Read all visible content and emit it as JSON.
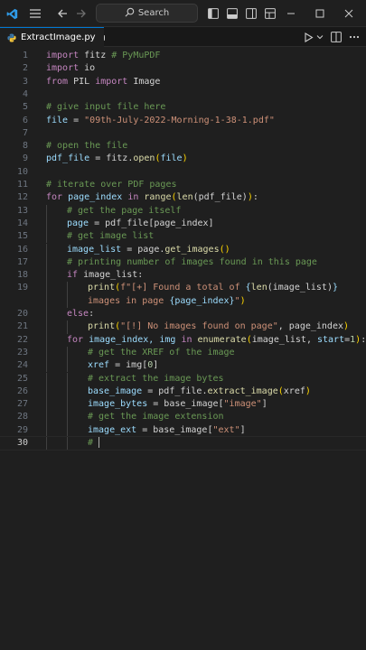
{
  "window": {
    "search_label": "Search"
  },
  "tab": {
    "filename": "ExtractImage.py"
  },
  "colors": {
    "accent": "#0078d4",
    "editor_bg": "#1f1f1f",
    "keyword": "#c586c0",
    "function": "#dcdcaa",
    "comment": "#6a9955",
    "string": "#ce9178",
    "variable": "#9cdcfe"
  },
  "editor": {
    "cursor_line": 30,
    "lines": [
      {
        "n": "1",
        "indent": 0,
        "tokens": [
          {
            "t": "import",
            "c": "kw"
          },
          {
            "t": " fitz ",
            "c": "df"
          },
          {
            "t": "# PyMuPDF",
            "c": "cm"
          }
        ]
      },
      {
        "n": "2",
        "indent": 0,
        "tokens": [
          {
            "t": "import",
            "c": "kw"
          },
          {
            "t": " io",
            "c": "df"
          }
        ]
      },
      {
        "n": "3",
        "indent": 0,
        "tokens": [
          {
            "t": "from",
            "c": "kw"
          },
          {
            "t": " PIL ",
            "c": "df"
          },
          {
            "t": "import",
            "c": "kw"
          },
          {
            "t": " Image",
            "c": "df"
          }
        ]
      },
      {
        "n": "4",
        "indent": 0,
        "tokens": []
      },
      {
        "n": "5",
        "indent": 0,
        "tokens": [
          {
            "t": "# give input file here",
            "c": "cm"
          }
        ]
      },
      {
        "n": "6",
        "indent": 0,
        "tokens": [
          {
            "t": "file",
            "c": "vr"
          },
          {
            "t": " = ",
            "c": "df"
          },
          {
            "t": "\"09th-July-2022-Morning-1-38-1.pdf\"",
            "c": "st"
          }
        ]
      },
      {
        "n": "7",
        "indent": 0,
        "tokens": []
      },
      {
        "n": "8",
        "indent": 0,
        "tokens": [
          {
            "t": "# open the file",
            "c": "cm"
          }
        ]
      },
      {
        "n": "9",
        "indent": 0,
        "tokens": [
          {
            "t": "pdf_file",
            "c": "vr"
          },
          {
            "t": " = fitz.",
            "c": "df"
          },
          {
            "t": "open",
            "c": "fn"
          },
          {
            "t": "(",
            "c": "br"
          },
          {
            "t": "file",
            "c": "vr"
          },
          {
            "t": ")",
            "c": "br"
          }
        ]
      },
      {
        "n": "10",
        "indent": 0,
        "tokens": []
      },
      {
        "n": "11",
        "indent": 0,
        "tokens": [
          {
            "t": "# iterate over PDF pages",
            "c": "cm"
          }
        ]
      },
      {
        "n": "12",
        "indent": 0,
        "tokens": [
          {
            "t": "for",
            "c": "kw"
          },
          {
            "t": " page_index ",
            "c": "vr"
          },
          {
            "t": "in",
            "c": "kw"
          },
          {
            "t": " ",
            "c": "df"
          },
          {
            "t": "range",
            "c": "fn"
          },
          {
            "t": "(",
            "c": "br"
          },
          {
            "t": "len",
            "c": "fn"
          },
          {
            "t": "(pdf_file)",
            "c": "df"
          },
          {
            "t": ")",
            "c": "br"
          },
          {
            "t": ":",
            "c": "df"
          }
        ]
      },
      {
        "n": "13",
        "indent": 1,
        "tokens": [
          {
            "t": "# get the page itself",
            "c": "cm"
          }
        ]
      },
      {
        "n": "14",
        "indent": 1,
        "tokens": [
          {
            "t": "page",
            "c": "vr"
          },
          {
            "t": " = pdf_file[page_index]",
            "c": "df"
          }
        ]
      },
      {
        "n": "15",
        "indent": 1,
        "tokens": [
          {
            "t": "# get image list",
            "c": "cm"
          }
        ]
      },
      {
        "n": "16",
        "indent": 1,
        "tokens": [
          {
            "t": "image_list",
            "c": "vr"
          },
          {
            "t": " = page.",
            "c": "df"
          },
          {
            "t": "get_images",
            "c": "fn"
          },
          {
            "t": "()",
            "c": "br"
          }
        ]
      },
      {
        "n": "17",
        "indent": 1,
        "tokens": [
          {
            "t": "# printing number of images found in this page",
            "c": "cm"
          }
        ]
      },
      {
        "n": "18",
        "indent": 1,
        "tokens": [
          {
            "t": "if",
            "c": "kw"
          },
          {
            "t": " image_list:",
            "c": "df"
          }
        ]
      },
      {
        "n": "19",
        "indent": 2,
        "tokens": [
          {
            "t": "print",
            "c": "fn"
          },
          {
            "t": "(",
            "c": "br"
          },
          {
            "t": "f\"[+] Found a total of ",
            "c": "st"
          },
          {
            "t": "{",
            "c": "vr"
          },
          {
            "t": "len",
            "c": "fn"
          },
          {
            "t": "(image_list)",
            "c": "df"
          },
          {
            "t": "}",
            "c": "vr"
          }
        ]
      },
      {
        "n": "",
        "indent": 2,
        "tokens": [
          {
            "t": "images in page ",
            "c": "st"
          },
          {
            "t": "{page_index}",
            "c": "vr"
          },
          {
            "t": "\"",
            "c": "st"
          },
          {
            "t": ")",
            "c": "br"
          }
        ]
      },
      {
        "n": "20",
        "indent": 1,
        "tokens": [
          {
            "t": "else",
            "c": "kw"
          },
          {
            "t": ":",
            "c": "df"
          }
        ]
      },
      {
        "n": "21",
        "indent": 2,
        "tokens": [
          {
            "t": "print",
            "c": "fn"
          },
          {
            "t": "(",
            "c": "br"
          },
          {
            "t": "\"[!] No images found on page\"",
            "c": "st"
          },
          {
            "t": ", page_index",
            "c": "df"
          },
          {
            "t": ")",
            "c": "br"
          }
        ]
      },
      {
        "n": "22",
        "indent": 1,
        "tokens": [
          {
            "t": "for",
            "c": "kw"
          },
          {
            "t": " image_index, img ",
            "c": "vr"
          },
          {
            "t": "in",
            "c": "kw"
          },
          {
            "t": " ",
            "c": "df"
          },
          {
            "t": "enumerate",
            "c": "fn"
          },
          {
            "t": "(",
            "c": "br"
          },
          {
            "t": "image_list, ",
            "c": "df"
          },
          {
            "t": "start",
            "c": "vr"
          },
          {
            "t": "=",
            "c": "df"
          },
          {
            "t": "1",
            "c": "nu"
          },
          {
            "t": ")",
            "c": "br"
          },
          {
            "t": ":",
            "c": "df"
          }
        ]
      },
      {
        "n": "23",
        "indent": 2,
        "tokens": [
          {
            "t": "# get the XREF of the image",
            "c": "cm"
          }
        ]
      },
      {
        "n": "24",
        "indent": 2,
        "tokens": [
          {
            "t": "xref",
            "c": "vr"
          },
          {
            "t": " = img[",
            "c": "df"
          },
          {
            "t": "0",
            "c": "nu"
          },
          {
            "t": "]",
            "c": "df"
          }
        ]
      },
      {
        "n": "25",
        "indent": 2,
        "tokens": [
          {
            "t": "# extract the image bytes",
            "c": "cm"
          }
        ]
      },
      {
        "n": "26",
        "indent": 2,
        "tokens": [
          {
            "t": "base_image",
            "c": "vr"
          },
          {
            "t": " = pdf_file.",
            "c": "df"
          },
          {
            "t": "extract_image",
            "c": "fn"
          },
          {
            "t": "(",
            "c": "br"
          },
          {
            "t": "xref",
            "c": "df"
          },
          {
            "t": ")",
            "c": "br"
          }
        ]
      },
      {
        "n": "27",
        "indent": 2,
        "tokens": [
          {
            "t": "image_bytes",
            "c": "vr"
          },
          {
            "t": " = base_image[",
            "c": "df"
          },
          {
            "t": "\"image\"",
            "c": "st"
          },
          {
            "t": "]",
            "c": "df"
          }
        ]
      },
      {
        "n": "28",
        "indent": 2,
        "tokens": [
          {
            "t": "# get the image extension",
            "c": "cm"
          }
        ]
      },
      {
        "n": "29",
        "indent": 2,
        "tokens": [
          {
            "t": "image_ext",
            "c": "vr"
          },
          {
            "t": " = base_image[",
            "c": "df"
          },
          {
            "t": "\"ext\"",
            "c": "st"
          },
          {
            "t": "]",
            "c": "df"
          }
        ]
      },
      {
        "n": "30",
        "indent": 2,
        "tokens": [
          {
            "t": "# ",
            "c": "cm"
          }
        ]
      }
    ]
  }
}
